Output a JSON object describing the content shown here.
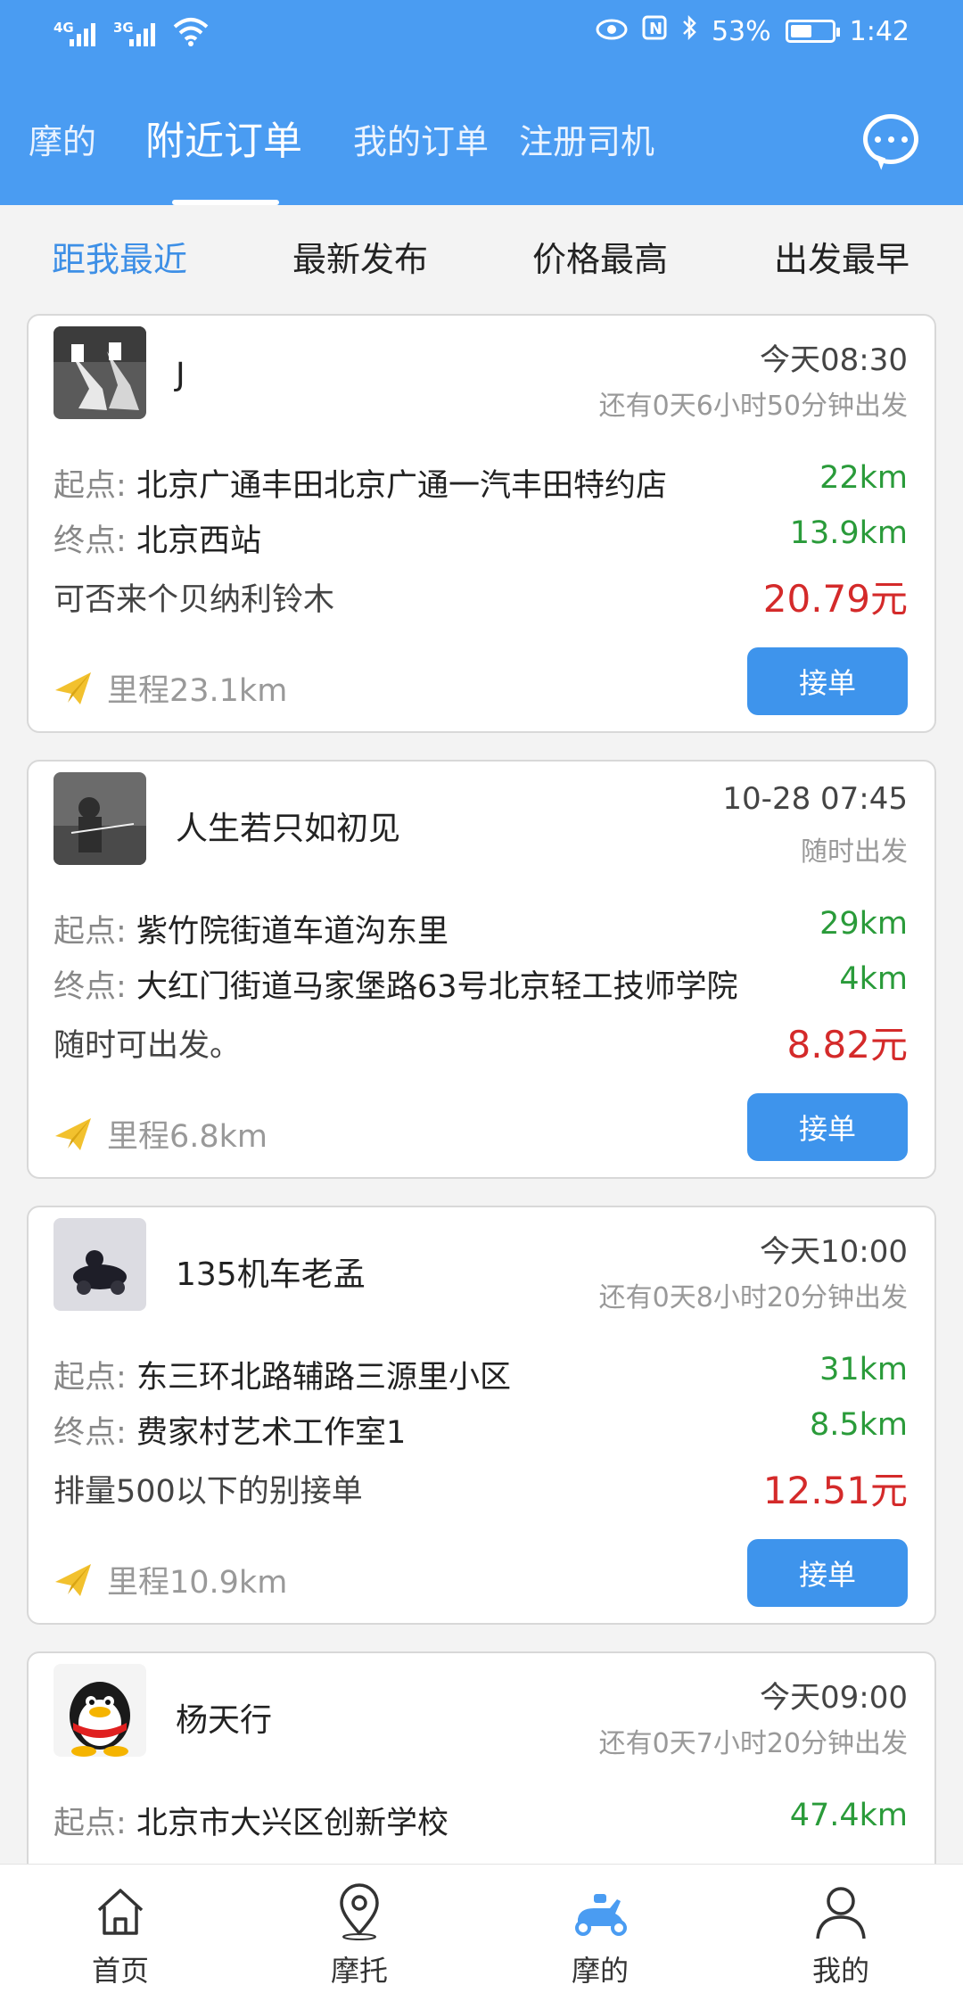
{
  "status_bar": {
    "network1": "4G",
    "network2": "3G",
    "battery": "53%",
    "time": "1:42",
    "battery_level": 0.53
  },
  "top_tabs": [
    "摩的",
    "附近订单",
    "我的订单",
    "注册司机"
  ],
  "sort_options": [
    "距我最近",
    "最新发布",
    "价格最高",
    "出发最早"
  ],
  "labels": {
    "start": "起点:",
    "end": "终点:",
    "mileage_prefix": "里程",
    "accept": "接单"
  },
  "orders": [
    {
      "name": "J",
      "time": "今天08:30",
      "depart": "还有0天6小时50分钟出发",
      "start": "北京广通丰田北京广通一汽丰田特约店",
      "start_dist": "22km",
      "end": "北京西站",
      "end_dist": "13.9km",
      "remark": "可否来个贝纳利铃木",
      "price": "20.79元",
      "mileage": "里程23.1km"
    },
    {
      "name": "人生若只如初见",
      "time": "10-28 07:45",
      "depart": "随时出发",
      "start": "紫竹院街道车道沟东里",
      "start_dist": "29km",
      "end": "大红门街道马家堡路63号北京轻工技师学院",
      "end_dist": "4km",
      "remark": "随时可出发。",
      "price": "8.82元",
      "mileage": "里程6.8km"
    },
    {
      "name": "135机车老孟",
      "time": "今天10:00",
      "depart": "还有0天8小时20分钟出发",
      "start": "东三环北路辅路三源里小区",
      "start_dist": "31km",
      "end": "费家村艺术工作室1",
      "end_dist": "8.5km",
      "remark": "排量500以下的别接单",
      "price": "12.51元",
      "mileage": "里程10.9km"
    },
    {
      "name": "杨天行",
      "time": "今天09:00",
      "depart": "还有0天7小时20分钟出发",
      "start": "北京市大兴区创新学校",
      "start_dist": "47.4km"
    }
  ],
  "bottom_nav": [
    "首页",
    "摩托",
    "摩的",
    "我的"
  ],
  "colors": {
    "primary": "#4a9cf2",
    "accent_blue": "#3d8fe6",
    "price_red": "#d42a2a",
    "distance_green": "#2a9b3a",
    "button_blue": "#3e94ec",
    "plane_yellow": "#f2c12e"
  },
  "icons": {
    "chat": "chat-bubble-icon",
    "mileage": "paper-plane-icon",
    "home": "home-icon",
    "moto": "map-pin-icon",
    "taxi": "scooter-icon",
    "me": "user-icon"
  }
}
